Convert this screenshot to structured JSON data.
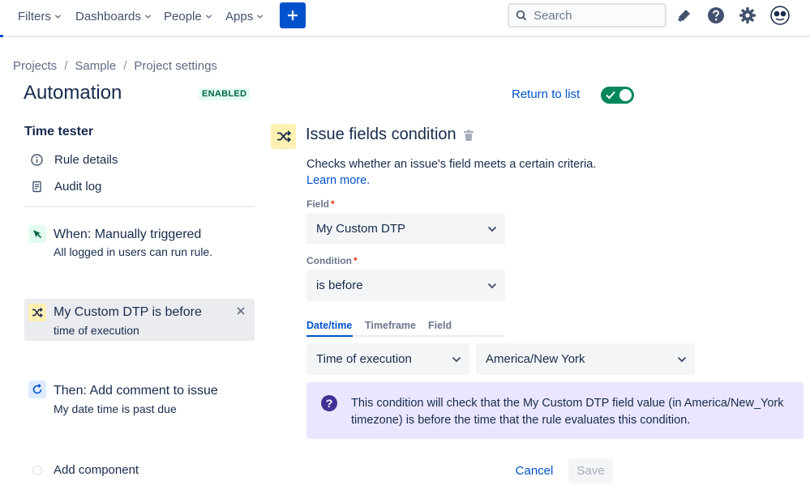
{
  "nav": {
    "items": [
      {
        "label": "Filters"
      },
      {
        "label": "Dashboards"
      },
      {
        "label": "People"
      },
      {
        "label": "Apps"
      }
    ],
    "search_placeholder": "Search"
  },
  "breadcrumb": [
    "Projects",
    "Sample",
    "Project settings"
  ],
  "breadcrumb_sep": "/",
  "header": {
    "title": "Automation",
    "badge": "ENABLED",
    "return_label": "Return to list",
    "enabled": true
  },
  "sidebar": {
    "rule_name": "Time tester",
    "links": [
      {
        "label": "Rule details",
        "icon": "info-icon"
      },
      {
        "label": "Audit log",
        "icon": "document-icon"
      }
    ],
    "components": [
      {
        "title": "When: Manually triggered",
        "subtitle": "All logged in users can run rule.",
        "icon": "cursor-trigger-icon",
        "color": "#e3fcef"
      },
      {
        "title": "My Custom DTP is before",
        "subtitle": "time of execution",
        "icon": "shuffle-icon",
        "color": "#fff0b3",
        "selected": true
      },
      {
        "title": "Then: Add comment to issue",
        "subtitle": "My date time is past due",
        "icon": "refresh-action-icon",
        "color": "#deebff"
      }
    ],
    "add_component": "Add component"
  },
  "panel": {
    "title": "Issue fields condition",
    "description": "Checks whether an issue's field meets a certain criteria.",
    "learn_more": "Learn more.",
    "field_label": "Field",
    "field_value": "My Custom DTP",
    "condition_label": "Condition",
    "condition_value": "is before",
    "required_mark": "*",
    "tabs": [
      {
        "label": "Date/time",
        "active": true
      },
      {
        "label": "Timeframe"
      },
      {
        "label": "Field"
      }
    ],
    "time_value": "Time of execution",
    "timezone_value": "America/New York",
    "info_icon": "?",
    "info_text": "This condition will check that the My Custom DTP field value (in America/New_York timezone) is before the time that the rule evaluates this condition.",
    "cancel_label": "Cancel",
    "save_label": "Save"
  },
  "colors": {
    "accent": "#0052cc",
    "enabled": "#00875a",
    "info_bg": "#eae6ff"
  }
}
